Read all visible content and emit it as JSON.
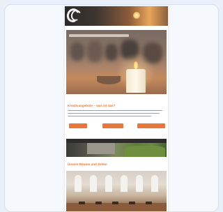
{
  "email": {
    "header": {
      "brand": "",
      "brand_sub": ""
    },
    "intro": {
      "heading": "Kreativangebote – was ist das?"
    },
    "buttons": [
      {
        "label": ""
      },
      {
        "label": ""
      },
      {
        "label": ""
      }
    ],
    "section": {
      "heading": "Unsere Räume und Zeiten"
    }
  },
  "colors": {
    "accent": "#e8773a",
    "page_bg": "#e9f0fa",
    "card_bg": "#f5f8fd"
  },
  "icons": {
    "logo": "double-ring-logo"
  }
}
